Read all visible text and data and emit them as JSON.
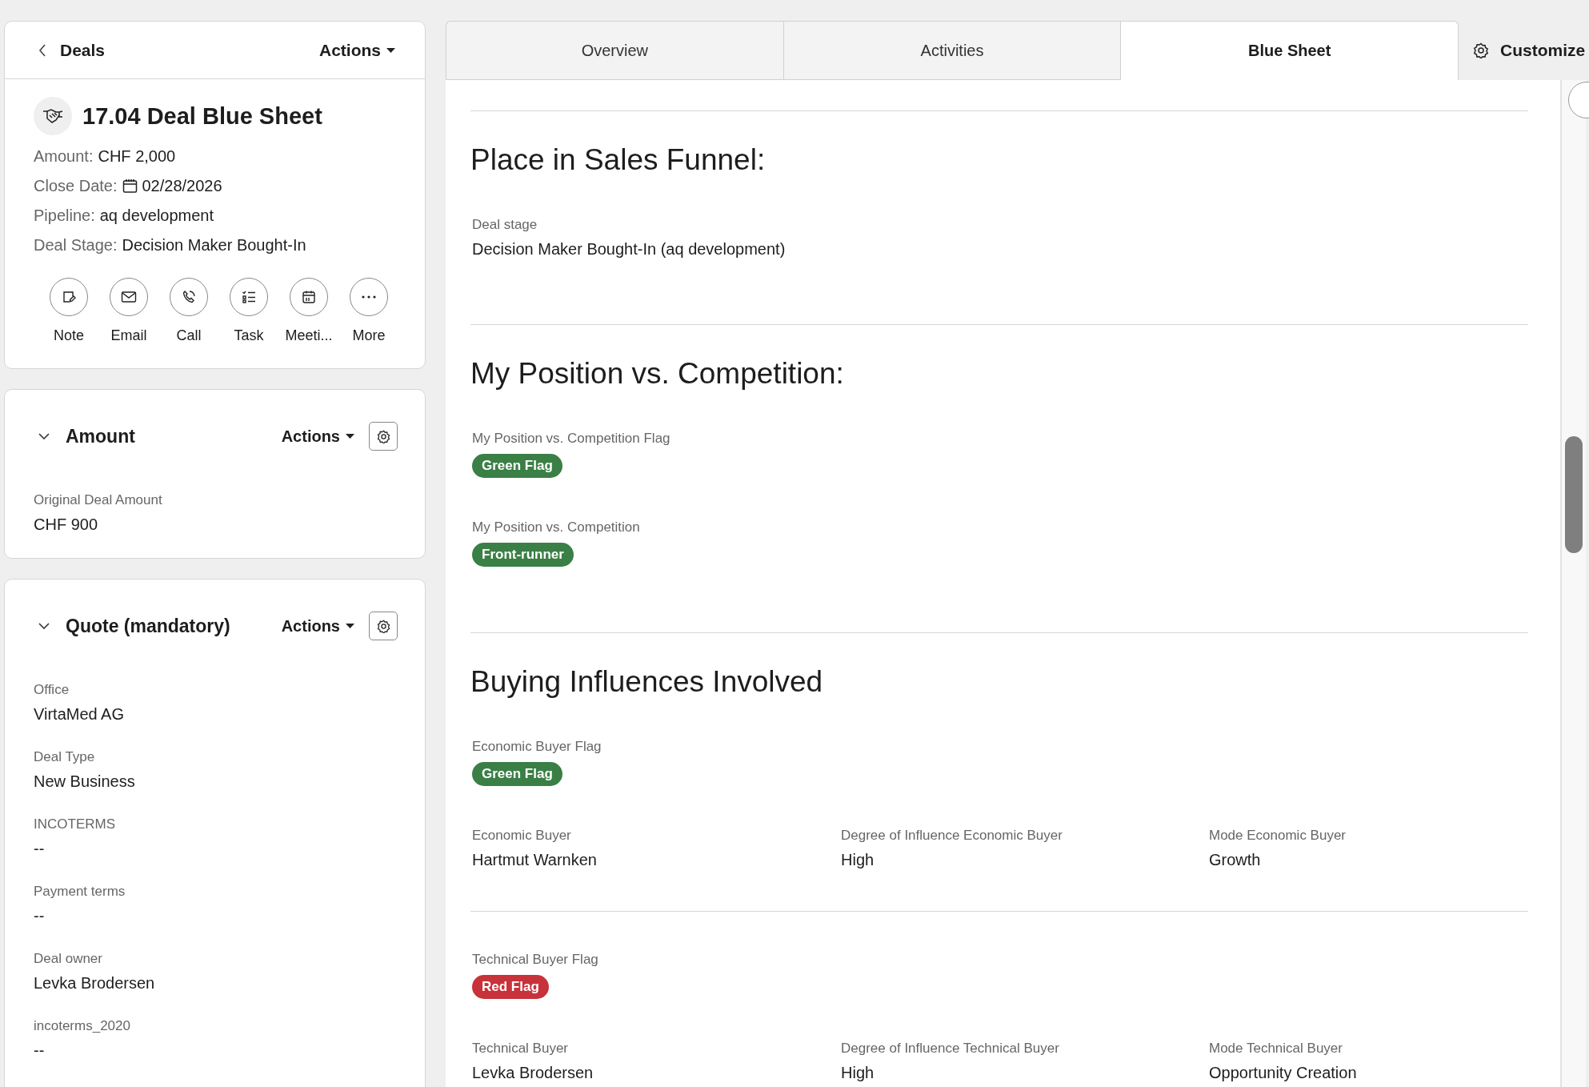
{
  "header": {
    "back_label": "Deals",
    "actions": "Actions"
  },
  "deal": {
    "title": "17.04 Deal Blue Sheet",
    "fields": [
      {
        "label": "Amount:",
        "value": "CHF 2,000",
        "kind": "text"
      },
      {
        "label": "Close Date:",
        "value": "02/28/2026",
        "kind": "date"
      },
      {
        "label": "Pipeline:",
        "value": "aq development",
        "kind": "text"
      },
      {
        "label": "Deal Stage:",
        "value": "Decision Maker Bought-In",
        "kind": "text"
      }
    ]
  },
  "quick_actions": [
    {
      "label": "Note",
      "kind": "note"
    },
    {
      "label": "Email",
      "kind": "email"
    },
    {
      "label": "Call",
      "kind": "call"
    },
    {
      "label": "Task",
      "kind": "task"
    },
    {
      "label": "Meeti...",
      "kind": "meeting"
    },
    {
      "label": "More",
      "kind": "more"
    }
  ],
  "cards": [
    {
      "title": "Amount",
      "expanded": true,
      "actions": "Actions",
      "fields": [
        {
          "label": "Original Deal Amount",
          "value": "CHF 900"
        }
      ]
    },
    {
      "title": "Quote (mandatory)",
      "expanded": true,
      "actions": "Actions",
      "fields": [
        {
          "label": "Office",
          "value": "VirtaMed AG"
        },
        {
          "label": "Deal Type",
          "value": "New Business"
        },
        {
          "label": "INCOTERMS",
          "value": "--"
        },
        {
          "label": "Payment terms",
          "value": "--"
        },
        {
          "label": "Deal owner",
          "value": "Levka Brodersen"
        },
        {
          "label": "incoterms_2020",
          "value": "--"
        }
      ]
    }
  ],
  "tabs": [
    {
      "label": "Overview",
      "selected": false
    },
    {
      "label": "Activities",
      "selected": false
    },
    {
      "label": "Blue Sheet",
      "selected": true
    }
  ],
  "customize": "Customize",
  "sections": [
    {
      "title": "Place in Sales Funnel:",
      "groups": [
        [
          [
            {
              "label": "Deal stage",
              "value": "Decision Maker Bought-In (aq development)",
              "kind": "text"
            }
          ]
        ]
      ]
    },
    {
      "title": "My Position vs. Competition:",
      "groups": [
        [
          [
            {
              "label": "My Position vs. Competition Flag",
              "value": "Green Flag",
              "kind": "tag",
              "color": "#3a7f45"
            }
          ],
          [
            {
              "label": "My Position vs. Competition",
              "value": "Front-runner",
              "kind": "tag",
              "color": "#3a7f45"
            }
          ]
        ]
      ]
    },
    {
      "title": "Buying Influences Involved",
      "groups": [
        [
          [
            {
              "label": "Economic Buyer Flag",
              "value": "Green Flag",
              "kind": "tag",
              "color": "#3a7f45"
            }
          ],
          [
            {
              "label": "Economic Buyer",
              "value": "Hartmut Warnken",
              "kind": "text"
            },
            {
              "label": "Degree of Influence Economic Buyer",
              "value": "High",
              "kind": "text"
            },
            {
              "label": "Mode Economic Buyer",
              "value": "Growth",
              "kind": "text"
            }
          ]
        ],
        [
          [
            {
              "label": "Technical Buyer Flag",
              "value": "Red Flag",
              "kind": "tag",
              "color": "#c8323a"
            }
          ],
          [
            {
              "label": "Technical Buyer",
              "value": "Levka Brodersen",
              "kind": "text"
            },
            {
              "label": "Degree of Influence Technical Buyer",
              "value": "High",
              "kind": "text"
            },
            {
              "label": "Mode Technical Buyer",
              "value": "Opportunity Creation",
              "kind": "text"
            }
          ]
        ]
      ]
    }
  ]
}
